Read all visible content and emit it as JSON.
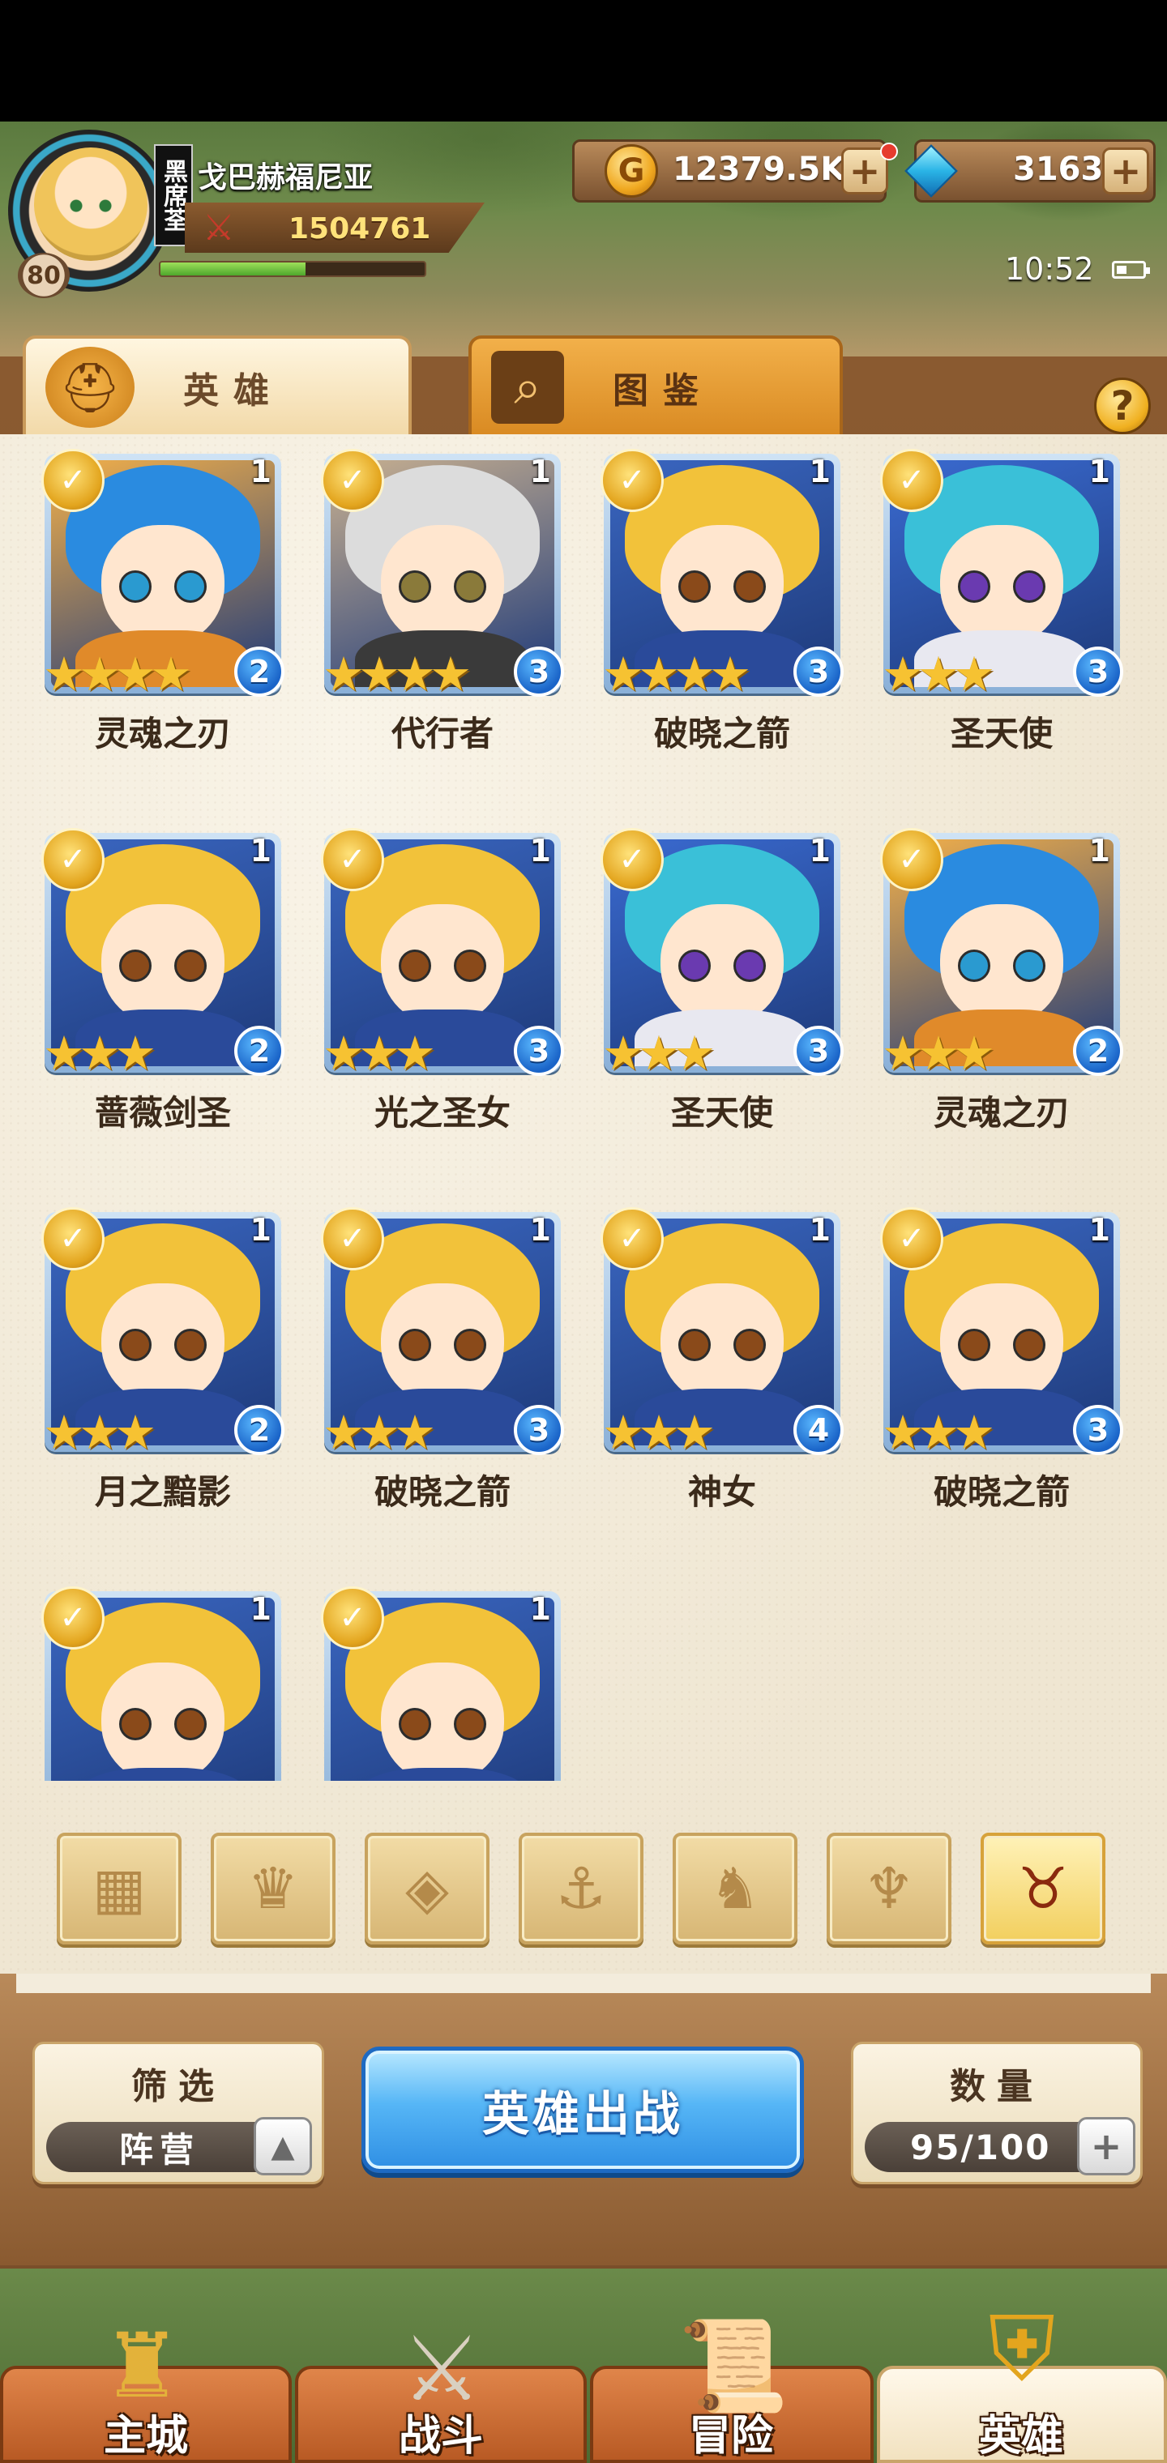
{
  "player": {
    "name": "戈巴赫福尼亚",
    "level": "80",
    "guild_badge": "黑席荃",
    "power": "1504761",
    "exp_fraction": 0.55
  },
  "resources": {
    "gold": "12379.5K",
    "gems": "3163",
    "plus": "+"
  },
  "status": {
    "time": "10:52"
  },
  "tabs": {
    "heroes": "英雄",
    "codex": "图鉴",
    "help": "?"
  },
  "heroes": [
    {
      "name": "灵魂之刃",
      "level": "1",
      "rank": "2",
      "stars": "★★★★"
    },
    {
      "name": "代行者",
      "level": "1",
      "rank": "3",
      "stars": "★★★★"
    },
    {
      "name": "破晓之箭",
      "level": "1",
      "rank": "3",
      "stars": "★★★★"
    },
    {
      "name": "圣天使",
      "level": "1",
      "rank": "3",
      "stars": "★★★"
    },
    {
      "name": "蔷薇剑圣",
      "level": "1",
      "rank": "2",
      "stars": "★★★"
    },
    {
      "name": "光之圣女",
      "level": "1",
      "rank": "3",
      "stars": "★★★"
    },
    {
      "name": "圣天使",
      "level": "1",
      "rank": "3",
      "stars": "★★★"
    },
    {
      "name": "灵魂之刃",
      "level": "1",
      "rank": "2",
      "stars": "★★★"
    },
    {
      "name": "月之黯影",
      "level": "1",
      "rank": "2",
      "stars": "★★★"
    },
    {
      "name": "破晓之箭",
      "level": "1",
      "rank": "3",
      "stars": "★★★"
    },
    {
      "name": "神女",
      "level": "1",
      "rank": "4",
      "stars": "★★★"
    },
    {
      "name": "破晓之箭",
      "level": "1",
      "rank": "3",
      "stars": "★★★"
    },
    {
      "name": "",
      "level": "1",
      "rank": "",
      "stars": ""
    },
    {
      "name": "",
      "level": "1",
      "rank": "",
      "stars": ""
    }
  ],
  "filter_icons": [
    "grid-icon",
    "crown-icon",
    "diamond-icon",
    "anchor-icon",
    "beast-icon",
    "horns-icon",
    "demon-icon"
  ],
  "controls": {
    "filter_title": "筛选",
    "filter_value": "阵营",
    "deploy_label": "英雄出战",
    "count_title": "数量",
    "count_value": "95/100"
  },
  "nav": {
    "city": "主城",
    "battle": "战斗",
    "adventure": "冒险",
    "heroes": "英雄"
  },
  "colors": {
    "accent_gold": "#f0b020",
    "deploy_blue": "#2f8fe4",
    "rank_blue": "#1a64c8"
  }
}
